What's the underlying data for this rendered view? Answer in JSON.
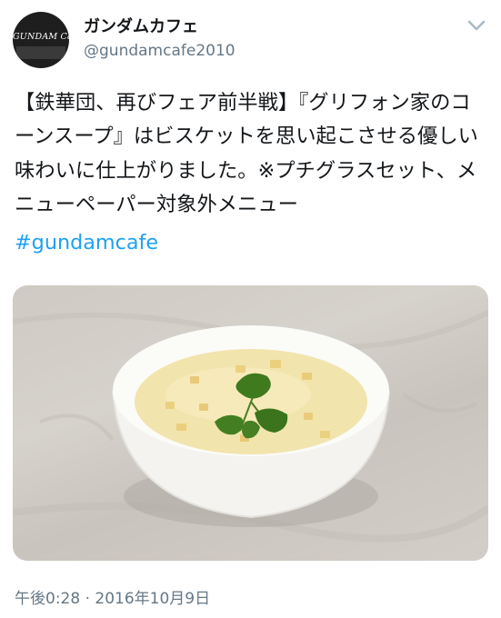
{
  "profile": {
    "display_name": "ガンダムカフェ",
    "handle": "@gundamcafe2010",
    "avatar_logo_text": "GUNDAM Cafe"
  },
  "tweet": {
    "text": "【鉄華団、再びフェア前半戦】『グリフォン家のコーンスープ』はビスケットを思い起こさせる優しい味わいに仕上がりました。※プチグラスセット、メニューペーパー対象外メニュー",
    "hashtag": "#gundamcafe",
    "timestamp": "午後0:28 · 2016年10月9日"
  },
  "media": {
    "alt": "corn soup in a white bowl garnished with parsley"
  },
  "icons": {
    "more": "chevron-down-icon"
  },
  "colors": {
    "link": "#1da1f2",
    "secondary_text": "#657786",
    "primary_text": "#14171a"
  }
}
